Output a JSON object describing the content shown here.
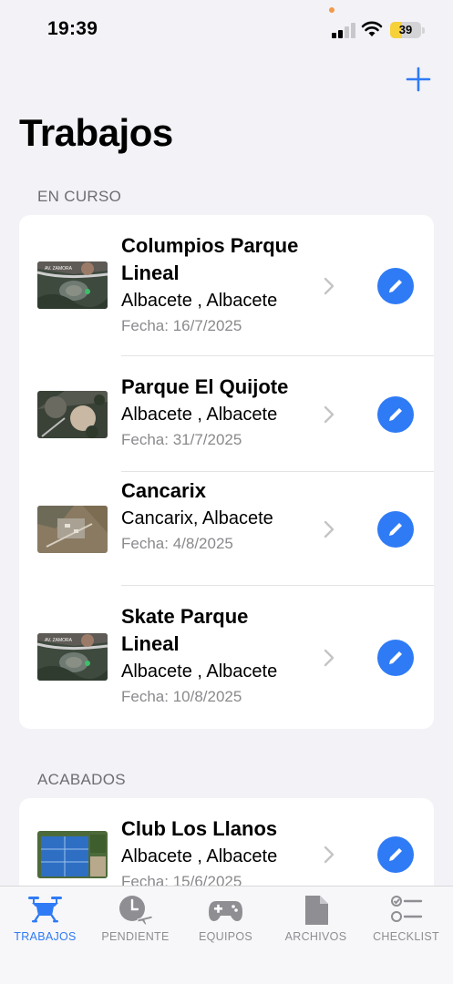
{
  "status_bar": {
    "time": "19:39",
    "battery_level": "39",
    "battery_color": "#f7d139",
    "icons": [
      "cellular-signal-icon",
      "wifi-icon",
      "battery-icon"
    ]
  },
  "header": {
    "title": "Trabajos",
    "add_icon": "plus-icon"
  },
  "sections": [
    {
      "header": "EN CURSO",
      "items": [
        {
          "title": "Columpios Parque Lineal",
          "location": "Albacete , Albacete",
          "date": "Fecha: 16/7/2025"
        },
        {
          "title": "Parque El Quijote",
          "location": "Albacete , Albacete",
          "date": "Fecha: 31/7/2025"
        },
        {
          "title": "Cancarix",
          "location": "Cancarix, Albacete",
          "date": "Fecha: 4/8/2025"
        },
        {
          "title": "Skate Parque Lineal",
          "location": "Albacete , Albacete",
          "date": "Fecha: 10/8/2025"
        }
      ]
    },
    {
      "header": "ACABADOS",
      "items": [
        {
          "title": "Club Los Llanos",
          "location": "Albacete , Albacete",
          "date": "Fecha: 15/6/2025"
        }
      ]
    }
  ],
  "tab_bar": {
    "active_color": "#2f7bf5",
    "tabs": [
      {
        "label": "TRABAJOS",
        "icon": "drone-icon",
        "active": true
      },
      {
        "label": "PENDIENTE",
        "icon": "clock-plane-icon",
        "active": false
      },
      {
        "label": "EQUIPOS",
        "icon": "gamepad-icon",
        "active": false
      },
      {
        "label": "ARCHIVOS",
        "icon": "document-icon",
        "active": false
      },
      {
        "label": "CHECKLIST",
        "icon": "checklist-icon",
        "active": false
      }
    ]
  },
  "accent_color": "#2f7bf5"
}
